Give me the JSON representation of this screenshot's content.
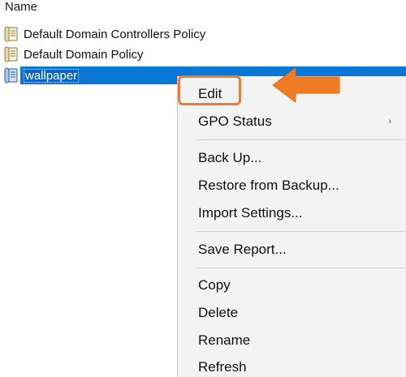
{
  "column_header": "Name",
  "tree": {
    "items": [
      {
        "label": "Default Domain Controllers Policy",
        "icon": "gpo-scroll-icon",
        "selected": false
      },
      {
        "label": "Default Domain Policy",
        "icon": "gpo-scroll-icon",
        "selected": false
      },
      {
        "label": "wallpaper",
        "icon": "gpo-scroll-icon",
        "selected": true
      }
    ]
  },
  "context_menu": {
    "items": [
      {
        "label": "Edit",
        "has_submenu": false
      },
      {
        "label": "GPO Status",
        "has_submenu": true,
        "submenu_glyph": "›"
      },
      {
        "label": "Back Up...",
        "has_submenu": false
      },
      {
        "label": "Restore from Backup...",
        "has_submenu": false
      },
      {
        "label": "Import Settings...",
        "has_submenu": false
      },
      {
        "label": "Save Report...",
        "has_submenu": false
      },
      {
        "label": "Copy",
        "has_submenu": false
      },
      {
        "label": "Delete",
        "has_submenu": false
      },
      {
        "label": "Rename",
        "has_submenu": false
      },
      {
        "label": "Refresh",
        "has_submenu": false
      }
    ]
  },
  "annotation": {
    "highlighted_item": "Edit",
    "color": "#f07c28"
  },
  "colors": {
    "selection": "#0a78d7",
    "menu_background": "#f3f3f3",
    "annotation": "#f07c28"
  }
}
